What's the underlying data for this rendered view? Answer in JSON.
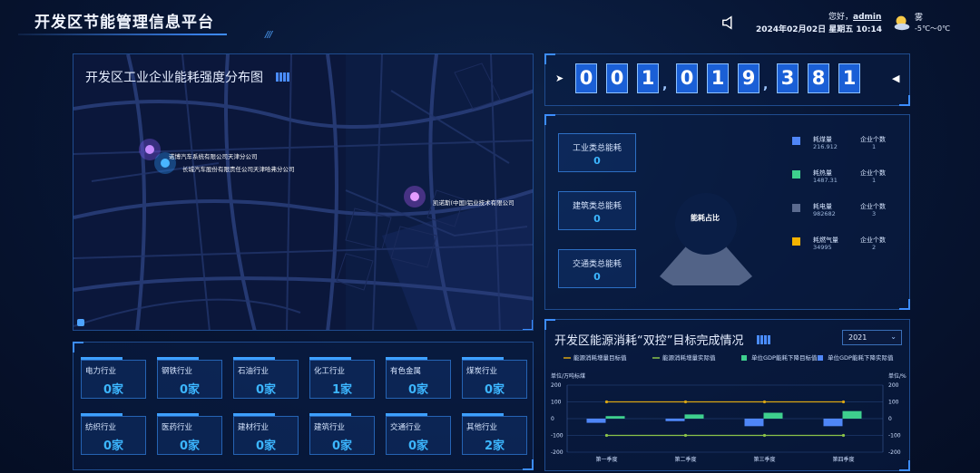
{
  "header": {
    "title": "开发区节能管理信息平台",
    "greeting_prefix": "您好，",
    "username": "admin",
    "date": "2024年02月02日",
    "weekday": "星期五",
    "time": "10:14",
    "weather_desc": "雾",
    "weather_temp": "-5℃～0℃",
    "icons": [
      "speaker-icon",
      "weather-icon"
    ]
  },
  "map": {
    "title": "开发区工业企业能耗强度分布图",
    "companies": [
      "诺博汽车系统有限公司天津分公司",
      "长城汽车股份有限责任公司天津哈弗分公司",
      "凯诺斯(中国)铝业技术有限公司"
    ]
  },
  "industries": [
    {
      "name": "电力行业",
      "count": "0家"
    },
    {
      "name": "钢铁行业",
      "count": "0家"
    },
    {
      "name": "石油行业",
      "count": "0家"
    },
    {
      "name": "化工行业",
      "count": "1家"
    },
    {
      "name": "有色金属",
      "count": "0家"
    },
    {
      "name": "煤炭行业",
      "count": "0家"
    },
    {
      "name": "纺织行业",
      "count": "0家"
    },
    {
      "name": "医药行业",
      "count": "0家"
    },
    {
      "name": "建材行业",
      "count": "0家"
    },
    {
      "name": "建筑行业",
      "count": "0家"
    },
    {
      "name": "交通行业",
      "count": "0家"
    },
    {
      "name": "其他行业",
      "count": "2家"
    }
  ],
  "counter": {
    "digits": [
      "0",
      "0",
      "1",
      "0",
      "1",
      "9",
      "3",
      "8",
      "1"
    ],
    "separator": ","
  },
  "energy": {
    "categories": [
      {
        "label": "工业类总能耗",
        "value": "0"
      },
      {
        "label": "建筑类总能耗",
        "value": "0"
      },
      {
        "label": "交通类总能耗",
        "value": "0"
      }
    ],
    "gauge_label": "能耗占比",
    "legend": [
      {
        "name": "耗煤量",
        "value": "216.912",
        "ent_label": "企业个数",
        "ent_count": "1",
        "color": "#4f86f7"
      },
      {
        "name": "耗热量",
        "value": "1487.31",
        "ent_label": "企业个数",
        "ent_count": "1",
        "color": "#3ecf8e"
      },
      {
        "name": "耗电量",
        "value": "982682",
        "ent_label": "企业个数",
        "ent_count": "3",
        "color": "#5b6b8f"
      },
      {
        "name": "耗燃气量",
        "value": "34995",
        "ent_label": "企业个数",
        "ent_count": "2",
        "color": "#f5b300"
      }
    ]
  },
  "dual_control": {
    "title": "开发区能源消耗“双控”目标完成情况",
    "year": "2021"
  },
  "chart_data": {
    "type": "bar",
    "categories": [
      "第一季度",
      "第二季度",
      "第三季度",
      "第四季度"
    ],
    "series": [
      {
        "name": "能源消耗增量目标值",
        "kind": "line",
        "color": "#d9a514",
        "values": [
          100,
          100,
          100,
          100
        ]
      },
      {
        "name": "能源消耗增量实际值",
        "kind": "line",
        "color": "#8bc34a",
        "values": [
          -100,
          -100,
          -100,
          -100
        ]
      },
      {
        "name": "单位GDP能耗下降目标值",
        "kind": "bar",
        "color": "#3ecf8e",
        "values": [
          15,
          25,
          35,
          45
        ]
      },
      {
        "name": "单位GDP能耗下降实际值",
        "kind": "bar",
        "color": "#4f86f7",
        "values": [
          -25,
          -15,
          -45,
          -45
        ]
      }
    ],
    "ylabel_left": "单位/万吨标煤",
    "ylabel_right": "单位/%",
    "ylim": [
      -200,
      200
    ],
    "yticks": [
      200,
      100,
      0,
      -100,
      -200
    ],
    "grid": true,
    "legend": "top"
  }
}
